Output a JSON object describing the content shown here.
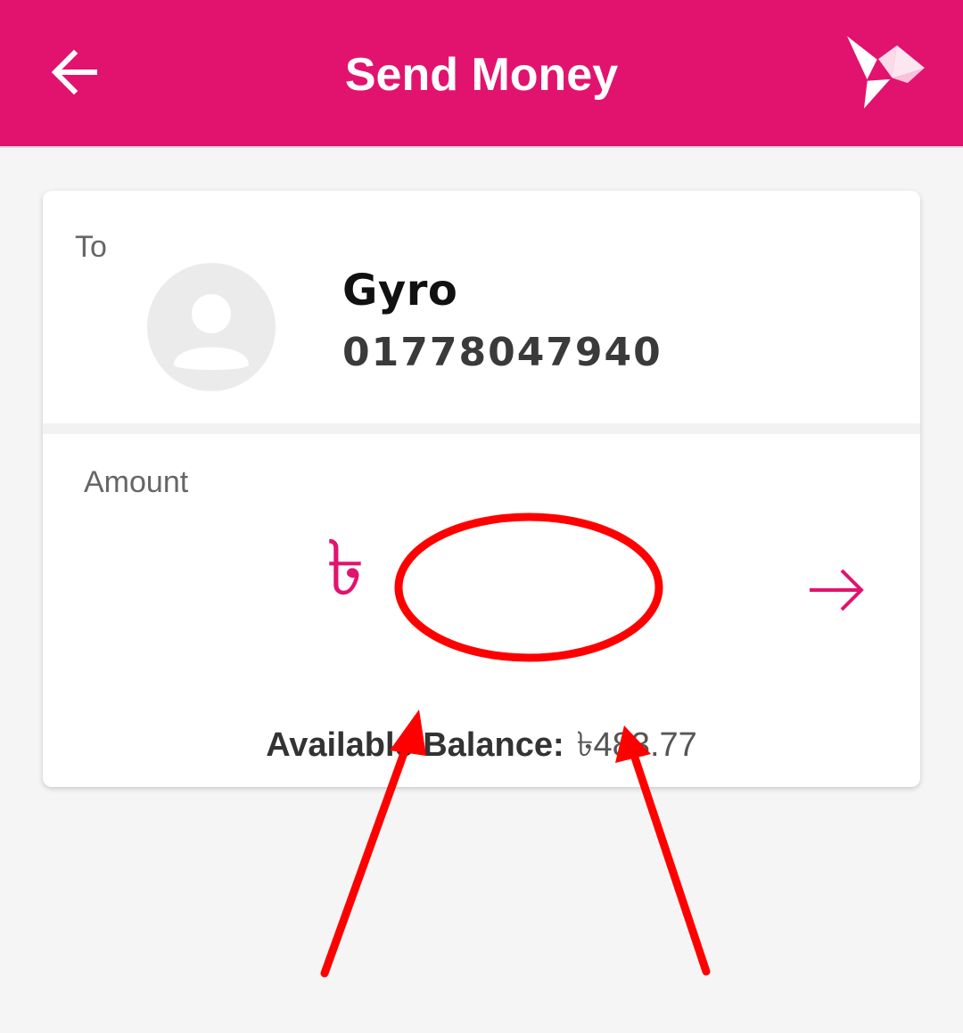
{
  "header": {
    "title": "Send Money",
    "back_icon": "arrow-left-icon",
    "logo_icon": "origami-bird-logo",
    "color": "#e2136e"
  },
  "recipient": {
    "label": "To",
    "name": "Gyro",
    "number": "01778047940",
    "avatar_icon": "person-placeholder-icon"
  },
  "amount": {
    "label": "Amount",
    "currency_symbol": "৳",
    "value": "",
    "next_icon": "arrow-right-icon"
  },
  "balance": {
    "label": "Available Balance:",
    "value": "৳483.77"
  },
  "annotations": {
    "color": "#ff0000",
    "shapes": [
      "ellipse",
      "arrow",
      "arrow"
    ]
  }
}
